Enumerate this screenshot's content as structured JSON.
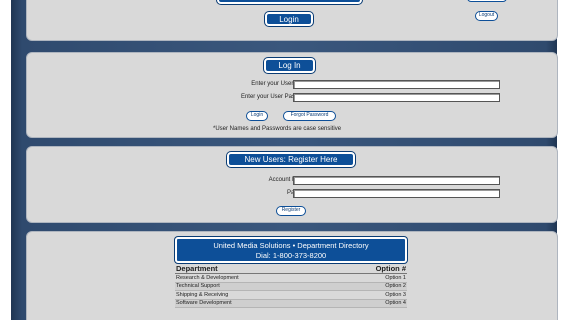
{
  "top": {
    "login_button": "Login",
    "logout_button": "Logout"
  },
  "login": {
    "header": "Log In",
    "username_label": "Enter your User Name*:",
    "password_label": "Enter your User Password*:",
    "login_button": "Login",
    "forgot_button": "Forgot Password",
    "note": "*User Names and Passwords are case sensitive"
  },
  "register": {
    "header": "New Users: Register Here",
    "account_label": "Account Number:",
    "password_label": "Password:",
    "register_button": "Register"
  },
  "directory": {
    "title_line1": "United Media Solutions • Department Directory",
    "title_line2": "Dial: 1-800-373-8200",
    "columns": [
      "Department",
      "Option #"
    ],
    "rows": [
      {
        "dept": "Research & Development",
        "opt": "Option 1"
      },
      {
        "dept": "Technical Support",
        "opt": "Option 2"
      },
      {
        "dept": "Shipping & Receiving",
        "opt": "Option 3"
      },
      {
        "dept": "Software Development",
        "opt": "Option 4"
      }
    ]
  },
  "colors": {
    "accent": "#0d4f98",
    "panel": "#d9d9d9",
    "backdrop": "#3a577d"
  }
}
